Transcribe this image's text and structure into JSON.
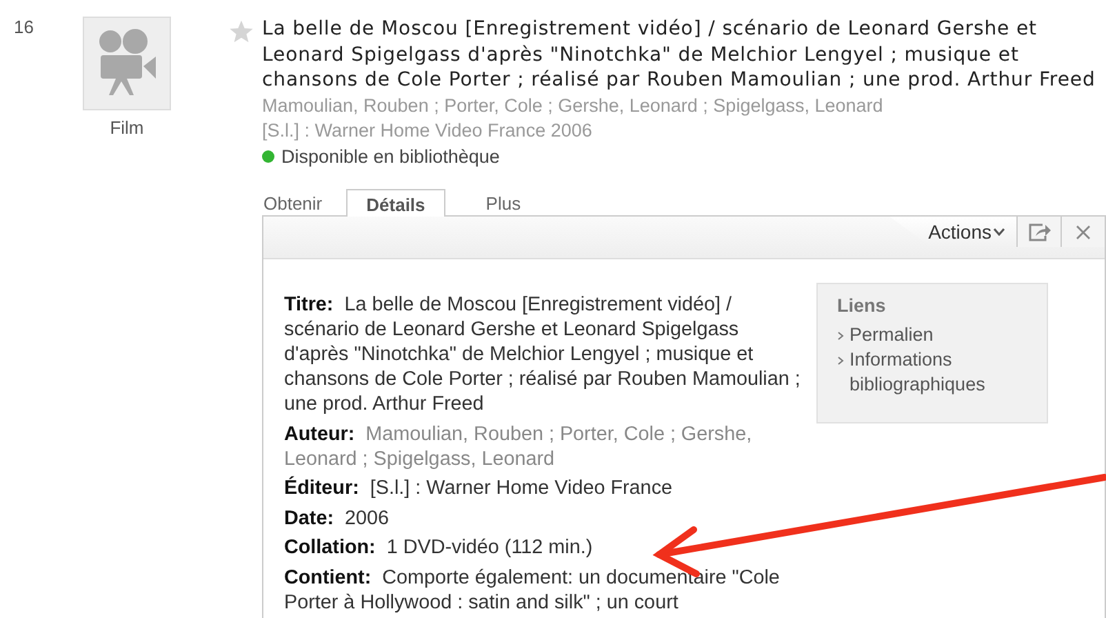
{
  "result": {
    "number": "16",
    "format": "Film",
    "starred": false,
    "title": "La belle de Moscou [Enregistrement vidéo] / scénario de Leonard Gershe et Leonard Spigelgass d'après \"Ninotchka\" de Melchior Lengyel ; musique et chansons de Cole Porter ; réalisé par Rouben Mamoulian ; une prod. Arthur Freed",
    "authors": "Mamoulian, Rouben ; Porter, Cole ; Gershe, Leonard ; Spigelgass, Leonard",
    "publisher": "[S.l.] : Warner Home Video France 2006",
    "availability": {
      "text": "Disponible en bibliothèque",
      "color": "#33b533"
    }
  },
  "tabs": [
    {
      "label": "Obtenir",
      "selected": false
    },
    {
      "label": "Détails",
      "selected": true
    },
    {
      "label": "Plus",
      "selected": false
    }
  ],
  "toolbar": {
    "actions": "Actions"
  },
  "details": [
    {
      "kind": "text",
      "text": "**Titre:** La belle de Moscou [Enregistrement vidéo] / scénario de Leonard Gershe et Leonard Spigelgass d'après \"Ninotchka\" de Melchior Lengyel ; musique et chansons de Cole Porter ; réalisé par Rouben Mamoulian ; une prod. Arthur Freed"
    },
    {
      "kind": "link",
      "text": "**Auteur:** Mamoulian, Rouben ; Porter, Cole ; Gershe, Leonard ; Spigelgass, Leonard"
    },
    {
      "kind": "text",
      "text": "**Éditeur:** [S.l.] : Warner Home Video France"
    },
    {
      "kind": "text",
      "text": "**Date:** 2006"
    },
    {
      "kind": "text",
      "text": "**Collation:** 1 DVD-vidéo (112 min.)"
    },
    {
      "kind": "text",
      "text": "**Contient:** Comporte également: un documentaire \"Cole Porter à Hollywood : satin and silk\" ; un court"
    }
  ],
  "links": {
    "title": "Liens",
    "items": [
      "Permalien",
      "Informations bibliographiques"
    ]
  }
}
